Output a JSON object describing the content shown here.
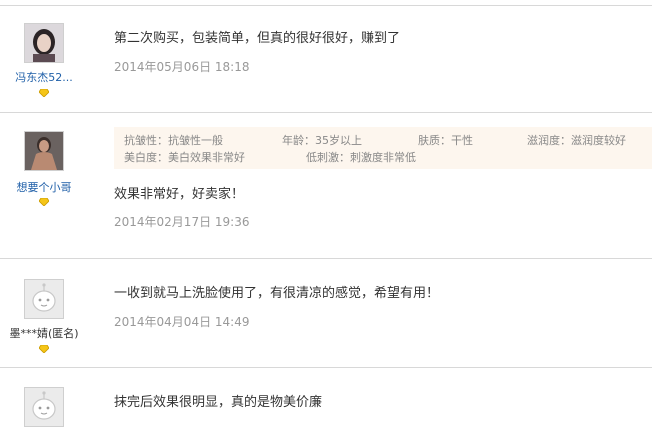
{
  "reviews": [
    {
      "username": "冯东杰52...",
      "content": "第二次购买，包装简单，但真的很好很好，赚到了",
      "date": "2014年05月06日 18:18"
    },
    {
      "username": "想要个小哥",
      "attributes": [
        "抗皱性：抗皱性一般",
        "年龄：35岁以上",
        "肤质：干性",
        "滋润度：滋润度较好",
        "美白度：美白效果非常好",
        "低刺激：刺激度非常低"
      ],
      "content": "效果非常好，好卖家！",
      "date": "2014年02月17日 19:36"
    },
    {
      "username": "墨***婧(匿名)",
      "content": "一收到就马上洗脸使用了，有很清凉的感觉，希望有用！",
      "date": "2014年04月04日 14:49"
    },
    {
      "content": "抹完后效果很明显，真的是物美价廉"
    }
  ],
  "colors": {
    "username_link": "#1f5fa8",
    "date_text": "#999999",
    "attr_background": "#fdf6ee",
    "rank_icon": "#f5c518"
  },
  "icons": {
    "rank": "diamond-rank-icon",
    "default_avatar": "default-avatar-face-icon"
  }
}
